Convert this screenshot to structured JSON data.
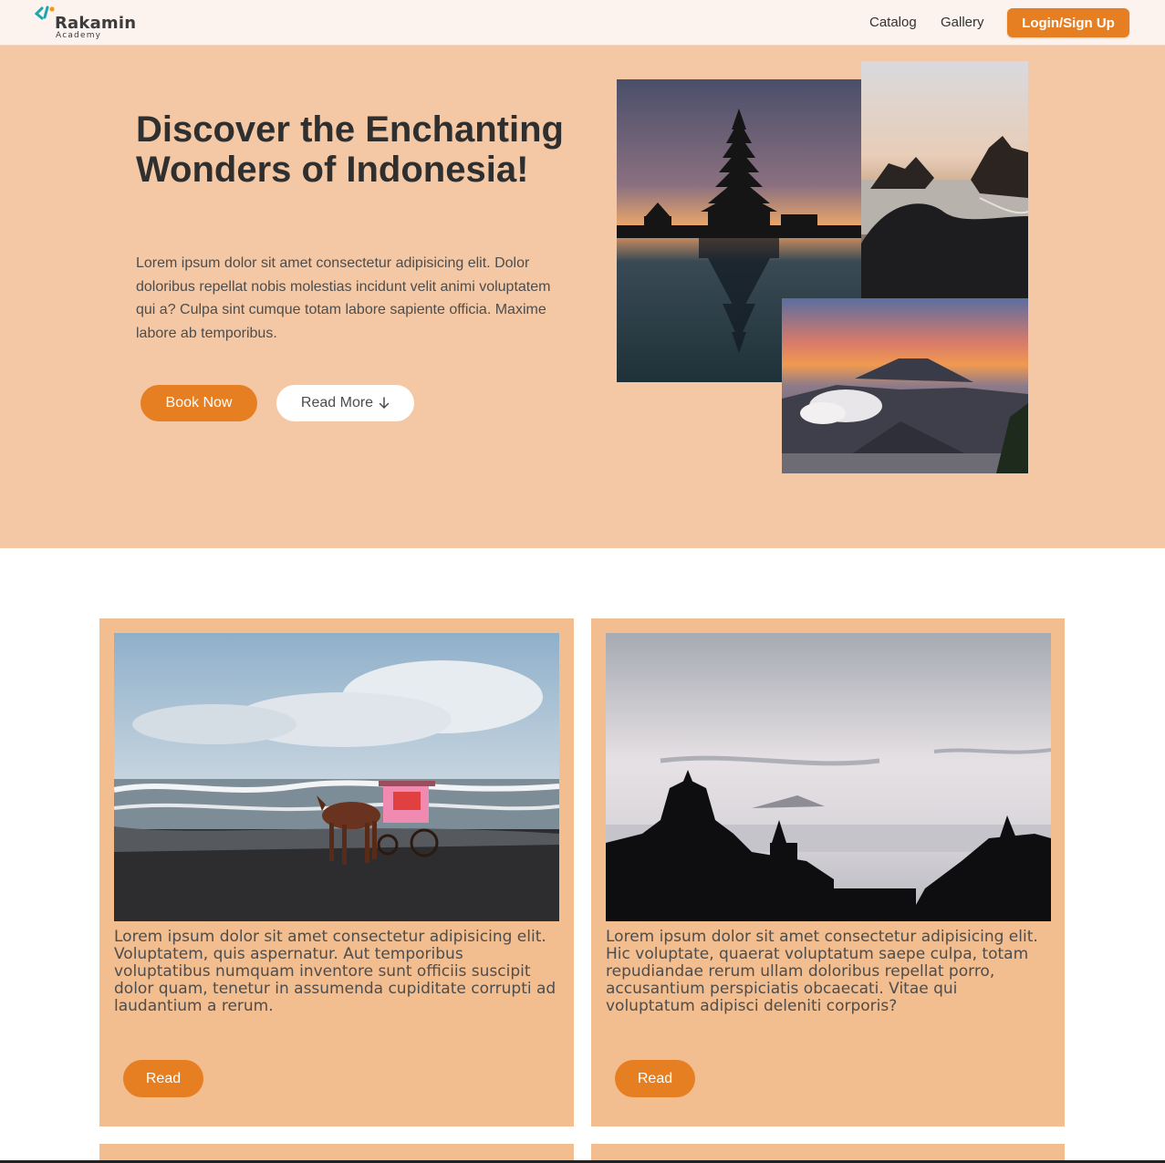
{
  "brand": {
    "name": "Rakamin",
    "subtitle": "Academy"
  },
  "nav": {
    "links": [
      "Catalog",
      "Gallery"
    ],
    "login_label": "Login/Sign Up"
  },
  "hero": {
    "title": "Discover the Enchanting Wonders of Indonesia!",
    "text": "Lorem ipsum dolor sit amet consectetur adipisicing elit. Dolor doloribus repellat nobis molestias incidunt velit animi voluptatem qui a? Culpa sint cumque totam labore sapiente officia. Maxime labore ab temporibus.",
    "book_label": "Book Now",
    "read_more_label": "Read More",
    "read_more_icon": "arrow-down-icon"
  },
  "cards": [
    {
      "text": "Lorem ipsum dolor sit amet consectetur adipisicing elit. Voluptatem, quis aspernatur. Aut temporibus voluptatibus numquam inventore sunt officiis suscipit dolor quam, tenetur in assumenda cupiditate corrupti ad laudantium a rerum.",
      "button_label": "Read"
    },
    {
      "text": "Lorem ipsum dolor sit amet consectetur adipisicing elit. Hic voluptate, quaerat voluptatum saepe culpa, totam repudiandae rerum ullam doloribus repellat porro, accusantium perspiciatis obcaecati. Vitae qui voluptatum adipisci deleniti corporis?",
      "button_label": "Read"
    }
  ],
  "colors": {
    "accent": "#e67e22",
    "hero_bg": "#f4c8a4",
    "card_bg": "#f2bd8f",
    "nav_bg": "#fdf3ee"
  }
}
